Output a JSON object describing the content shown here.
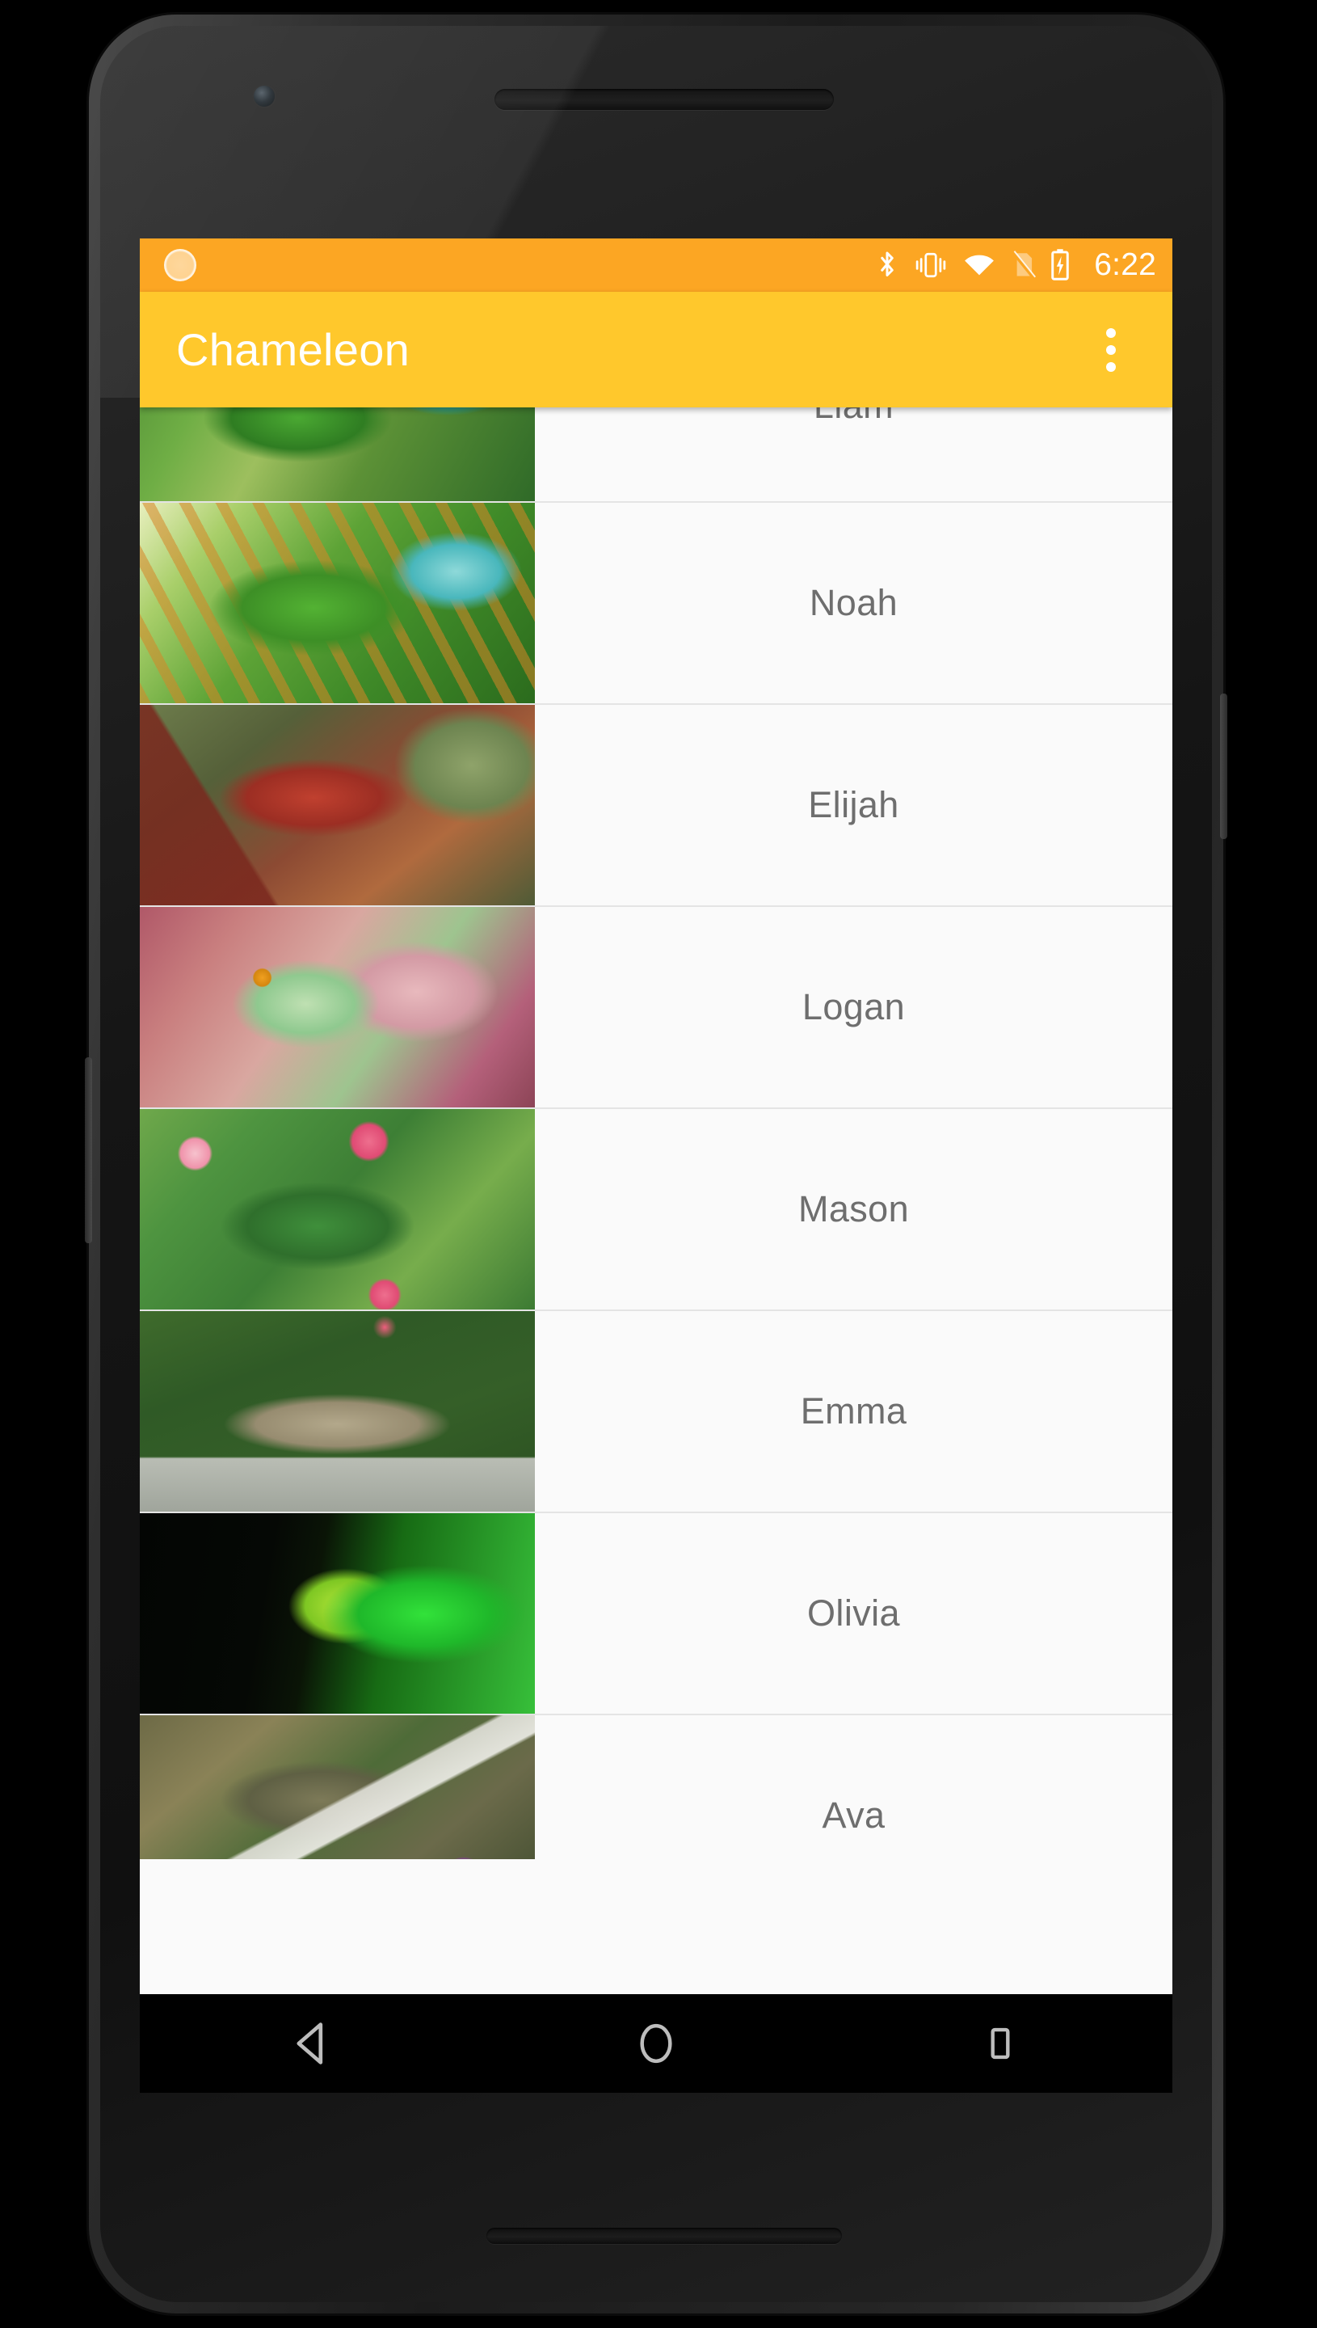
{
  "device": {
    "hardware": {
      "front_camera": "front-camera",
      "earpiece": "earpiece-speaker",
      "bottom_speaker": "bottom-speaker",
      "power_button": "power-button",
      "volume_button": "volume-button"
    }
  },
  "status_bar": {
    "background_color": "#fca623",
    "left_icon": "sync-circle-icon",
    "icons": [
      "bluetooth-icon",
      "vibrate-mode-icon",
      "wifi-icon",
      "no-sim-card-icon",
      "battery-charging-icon"
    ],
    "time": "6:22"
  },
  "app_bar": {
    "background_color": "#ffc82c",
    "title": "Chameleon",
    "overflow_menu": "overflow-menu-icon"
  },
  "list": {
    "background_color": "#fafafa",
    "text_color": "#6e6e6e",
    "divider_color": "#e4e4e4",
    "items": [
      {
        "name": "Liam",
        "thumb": "veiled-chameleon-teal-spotted-leafy",
        "clipped": true
      },
      {
        "name": "Noah",
        "thumb": "veiled-chameleon-green-orange-stripes"
      },
      {
        "name": "Elijah",
        "thumb": "red-chameleon-on-branch"
      },
      {
        "name": "Logan",
        "thumb": "pastel-panther-chameleon-head"
      },
      {
        "name": "Mason",
        "thumb": "jacksons-chameleon-pink-flowers"
      },
      {
        "name": "Emma",
        "thumb": "brown-garden-lizard-on-ledge"
      },
      {
        "name": "Olivia",
        "thumb": "bright-green-chameleon-black-background"
      },
      {
        "name": "Ava",
        "thumb": "chameleon-on-birch-branch-purple-flowers"
      }
    ]
  },
  "nav_bar": {
    "background_color": "#000000",
    "buttons": [
      {
        "name": "back-button",
        "icon": "back-triangle-icon"
      },
      {
        "name": "home-button",
        "icon": "home-circle-icon"
      },
      {
        "name": "recents-button",
        "icon": "recents-square-icon"
      }
    ]
  }
}
